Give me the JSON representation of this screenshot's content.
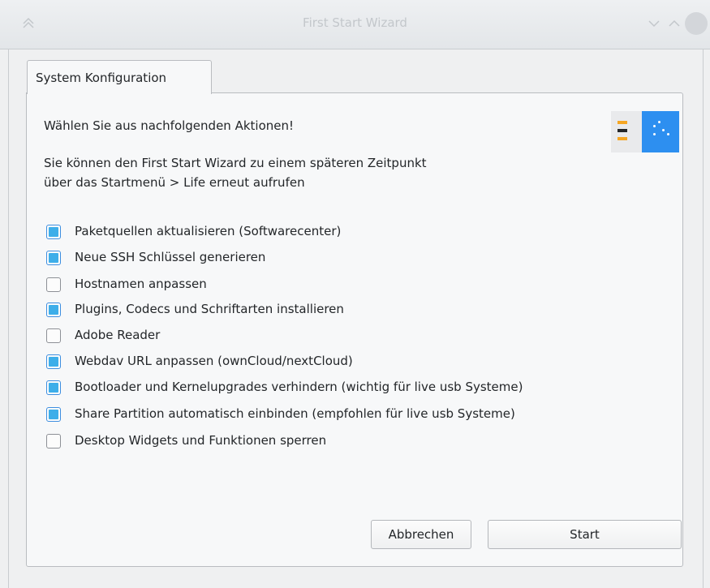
{
  "window": {
    "title": "First Start Wizard"
  },
  "titlebar_icons": [
    "keep-above-icon",
    "minimize-icon",
    "maximize-icon",
    "close-icon"
  ],
  "tab": {
    "label": "System Konfiguration"
  },
  "content": {
    "heading": "Wählen Sie aus nachfolgenden Aktionen!",
    "info_line1": "Sie können den First Start Wizard zu einem späteren Zeitpunkt",
    "info_line2": "über das Startmenü > Life erneut aufrufen"
  },
  "options": [
    {
      "label": "Paketquellen aktualisieren (Softwarecenter)",
      "checked": true
    },
    {
      "label": "Neue SSH Schlüssel generieren",
      "checked": true
    },
    {
      "label": "Hostnamen anpassen",
      "checked": false
    },
    {
      "label": "Plugins, Codecs und Schriftarten installieren",
      "checked": true
    },
    {
      "label": "Adobe Reader",
      "checked": false
    },
    {
      "label": "Webdav URL anpassen (ownCloud/nextCloud)",
      "checked": true
    },
    {
      "label": "Bootloader und Kernelupgrades verhindern (wichtig für live usb Systeme)",
      "checked": true
    },
    {
      "label": "Share Partition automatisch einbinden (empfohlen für live usb Systeme)",
      "checked": true
    },
    {
      "label": "Desktop Widgets und Funktionen sperren",
      "checked": false
    }
  ],
  "buttons": {
    "cancel": "Abbrechen",
    "start": "Start"
  },
  "colors": {
    "accent": "#3daee9",
    "logo_blue": "#2d8ff0",
    "logo_orange": "#f5a623"
  }
}
